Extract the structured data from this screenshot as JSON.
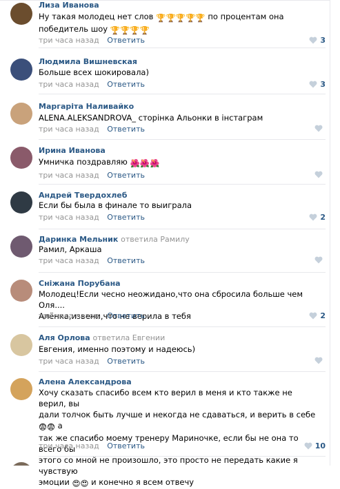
{
  "comments": [
    {
      "author": "Лиза Иванова",
      "reply_to_label": "",
      "reply_to_name": "",
      "text_parts": [
        "Ну такая молодец нет слов",
        "по процентам она победитель шоу"
      ],
      "time": "три часа назад",
      "reply_label": "Ответить",
      "likes": "3",
      "avatar_color": "#6b4d2e"
    },
    {
      "author": "Людмила Вишневская",
      "text": "Больше всех шокировала)",
      "time": "три часа назад",
      "reply_label": "Ответить",
      "likes": "3",
      "avatar_color": "#3b4f7a"
    },
    {
      "author": "Маргарiта Наливайко",
      "text": "ALENA.ALEKSANDROVA_ сторінка Альонки в інстаграм",
      "time": "три часа назад",
      "reply_label": "Ответить",
      "likes": "",
      "avatar_color": "#c9a27b"
    },
    {
      "author": "Ирина Иванова",
      "text": "Умничка поздравляю",
      "time": "три часа назад",
      "reply_label": "Ответить",
      "likes": "",
      "avatar_color": "#8a5a6a"
    },
    {
      "author": "Андрей Твердохлеб",
      "text": "Если бы была в финале то выиграла",
      "time": "три часа назад",
      "reply_label": "Ответить",
      "likes": "2",
      "avatar_color": "#2f3a44"
    },
    {
      "author": "Даринка Мельник",
      "reply_to_label": "ответила Рамилу",
      "text": "Рамил, Аркаша",
      "time": "три часа назад",
      "reply_label": "Ответить",
      "likes": "",
      "avatar_color": "#6f5a70"
    },
    {
      "author": "Сніжана Порубана",
      "text_lines": [
        "Молодец!Если чесно неожидано,что она сбросила больше чем Оля....",
        "Алёнка,извени,что не верила в тебя"
      ],
      "time": "три часа назад",
      "reply_label": "Ответить",
      "likes": "2",
      "avatar_color": "#b88c7a"
    },
    {
      "author": "Аля Орлова",
      "reply_to_label": "ответила Евгении",
      "text": "Евгения, именно поэтому и надеюсь)",
      "time": "три часа назад",
      "reply_label": "Ответить",
      "likes": "",
      "avatar_color": "#d8c6a0"
    },
    {
      "author": "Алена Александрова",
      "text_lines": [
        "Хочу сказать спасибо всем кто верил в меня и кто также не верил, вы",
        "дали толчок быть лучше и некогда не сдаваться, и верить в себе",
        "а",
        "так же спасибо моему тренеру Мариночке, если бы не она то всего бы",
        "этого со мной не произошло, это просто не передать какие я чувствую",
        "эмоции",
        "и конечно я всем отвечу"
      ],
      "time": "три часа назад",
      "reply_label": "Ответить",
      "likes": "10",
      "avatar_color": "#d4a35c"
    }
  ],
  "icons": {
    "like": "heart-icon",
    "trophy": "trophy-emoji",
    "flower": "flower-emoji",
    "shock": "shock-emoji",
    "love": "heart-eyes-emoji"
  },
  "colors": {
    "link": "#2a5885",
    "meta": "#939393",
    "divider": "#e7e8ec",
    "heart": "#c5d0db"
  }
}
